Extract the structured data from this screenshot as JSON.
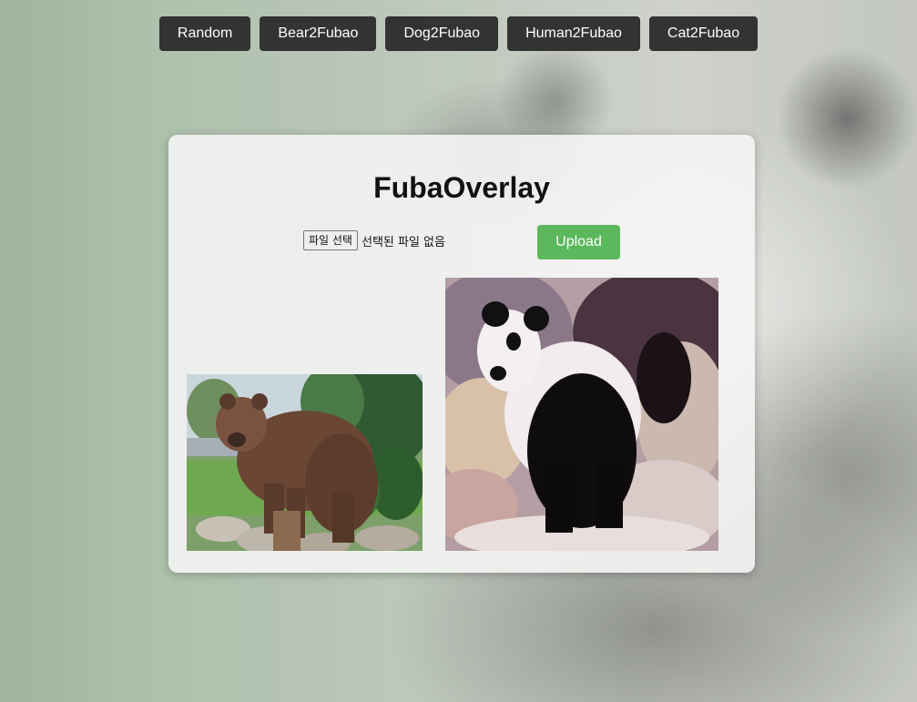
{
  "nav": {
    "buttons": [
      {
        "label": "Random"
      },
      {
        "label": "Bear2Fubao"
      },
      {
        "label": "Dog2Fubao"
      },
      {
        "label": "Human2Fubao"
      },
      {
        "label": "Cat2Fubao"
      }
    ]
  },
  "main": {
    "title": "FubaOverlay",
    "file_input": {
      "button_label": "파일 선택",
      "status": "선택된 파일 없음"
    },
    "upload_label": "Upload"
  },
  "colors": {
    "nav_button": "#333333",
    "upload_button": "#5cb85c"
  },
  "icons": {
    "input_image": "brown-bear-photo",
    "output_image": "panda-overlay-photo"
  }
}
